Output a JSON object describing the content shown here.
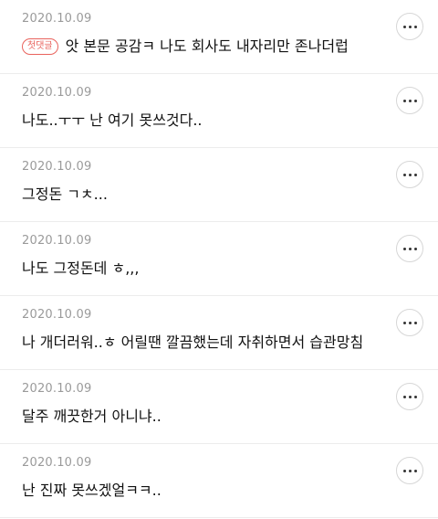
{
  "comments": [
    {
      "date": "2020.10.09",
      "badge": "첫댓글",
      "text": "앗 본문 공감ㅋ  나도 회사도 내자리만 존나더럽"
    },
    {
      "date": "2020.10.09",
      "text": "나도..ㅜㅜ 난 여기 못쓰것다.."
    },
    {
      "date": "2020.10.09",
      "text": "그정돈 ㄱㅊ..."
    },
    {
      "date": "2020.10.09",
      "text": "나도 그정돈데 ㅎ,,,"
    },
    {
      "date": "2020.10.09",
      "text": "나 개더러워..ㅎ 어릴땐 깔끔했는데 자취하면서 습관망침"
    },
    {
      "date": "2020.10.09",
      "text": "달주 깨끗한거 아니냐.."
    },
    {
      "date": "2020.10.09",
      "text": "난 진짜 못쓰겠얼ㅋㅋ.."
    }
  ],
  "icons": {
    "more": "more-dots-icon"
  },
  "colors": {
    "badge": "#e9635d",
    "date": "#9a9a9a",
    "divider": "#ececec"
  }
}
